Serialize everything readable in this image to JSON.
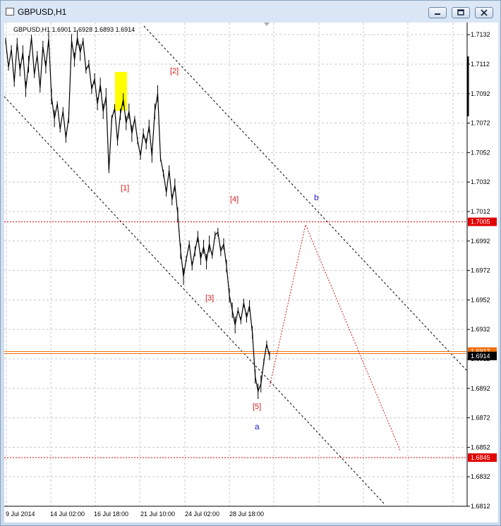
{
  "window": {
    "title": "GBPUSD,H1",
    "minimize_icon": "minimize-icon",
    "restore_icon": "restore-icon",
    "close_icon": "close-icon"
  },
  "chart_info": "GBPUSD,H1  1.6901 1.6928 1.6893 1.6914",
  "chart_data": {
    "type": "line",
    "symbol": "GBPUSD",
    "timeframe": "H1",
    "ohlc_last": {
      "open": 1.6901,
      "high": 1.6928,
      "low": 1.6893,
      "close": 1.6914
    },
    "y_ticks": [
      "1.7132",
      "1.7112",
      "1.7092",
      "1.7072",
      "1.7052",
      "1.7032",
      "1.7012",
      "1.6992",
      "1.6972",
      "1.6952",
      "1.6932",
      "1.6912",
      "1.6892",
      "1.6872",
      "1.6852",
      "1.6832",
      "1.6812"
    ],
    "ylim": [
      1.6805,
      1.714
    ],
    "x_ticks": [
      "9 Jul 2014",
      "14 Jul 02:00",
      "16 Jul 18:00",
      "21 Jul 10:00",
      "24 Jul 02:00",
      "28 Jul 18:00"
    ],
    "price_line_labels": [
      {
        "value": 1.7005,
        "label": "1.7005",
        "color": "#e00000"
      },
      {
        "value": 1.6917,
        "label": "1.6917",
        "color": "#f07010"
      },
      {
        "value": 1.6914,
        "label": "1.6914",
        "color": "#000000"
      },
      {
        "value": 1.6845,
        "label": "1.6845",
        "color": "#e00000"
      }
    ],
    "wave_labels": [
      {
        "text": "[1]",
        "color": "#d21c1c"
      },
      {
        "text": "[2]",
        "color": "#d21c1c"
      },
      {
        "text": "[3]",
        "color": "#d21c1c"
      },
      {
        "text": "[4]",
        "color": "#d21c1c"
      },
      {
        "text": "[5]",
        "color": "#d21c1c"
      },
      {
        "text": "a",
        "color": "#1e1ec8"
      },
      {
        "text": "b",
        "color": "#1e1ec8"
      }
    ],
    "price_path": [
      1.7128,
      1.711,
      1.7122,
      1.71,
      1.7126,
      1.7108,
      1.712,
      1.7095,
      1.7112,
      1.713,
      1.7105,
      1.7118,
      1.7096,
      1.7124,
      1.711,
      1.7129,
      1.709,
      1.7075,
      1.7085,
      1.7068,
      1.708,
      1.7062,
      1.7076,
      1.7128,
      1.7115,
      1.713,
      1.712,
      1.7128,
      1.7108,
      1.7112,
      1.7095,
      1.7102,
      1.7085,
      1.7098,
      1.708,
      1.709,
      1.704,
      1.7075,
      1.7082,
      1.706,
      1.7078,
      1.7088,
      1.7072,
      1.708,
      1.7065,
      1.7075,
      1.706,
      1.705,
      1.7065,
      1.7058,
      1.707,
      1.705,
      1.708,
      1.7092,
      1.7048,
      1.7038,
      1.7025,
      1.704,
      1.702,
      1.703,
      1.701,
      1.6985,
      1.6968,
      1.698,
      1.699,
      1.6975,
      1.6985,
      1.6995,
      1.698,
      1.6988,
      1.6978,
      1.699,
      1.6982,
      1.6996,
      1.6998,
      1.6985,
      1.699,
      1.6975,
      1.6955,
      1.6945,
      1.6935,
      1.6945,
      1.6938,
      1.695,
      1.694,
      1.6948,
      1.693,
      1.69,
      1.689,
      1.6895,
      1.691,
      1.6922,
      1.6914
    ],
    "projection_path": [
      1.6893,
      1.7003,
      1.685
    ],
    "grid": true,
    "legend": "none"
  }
}
